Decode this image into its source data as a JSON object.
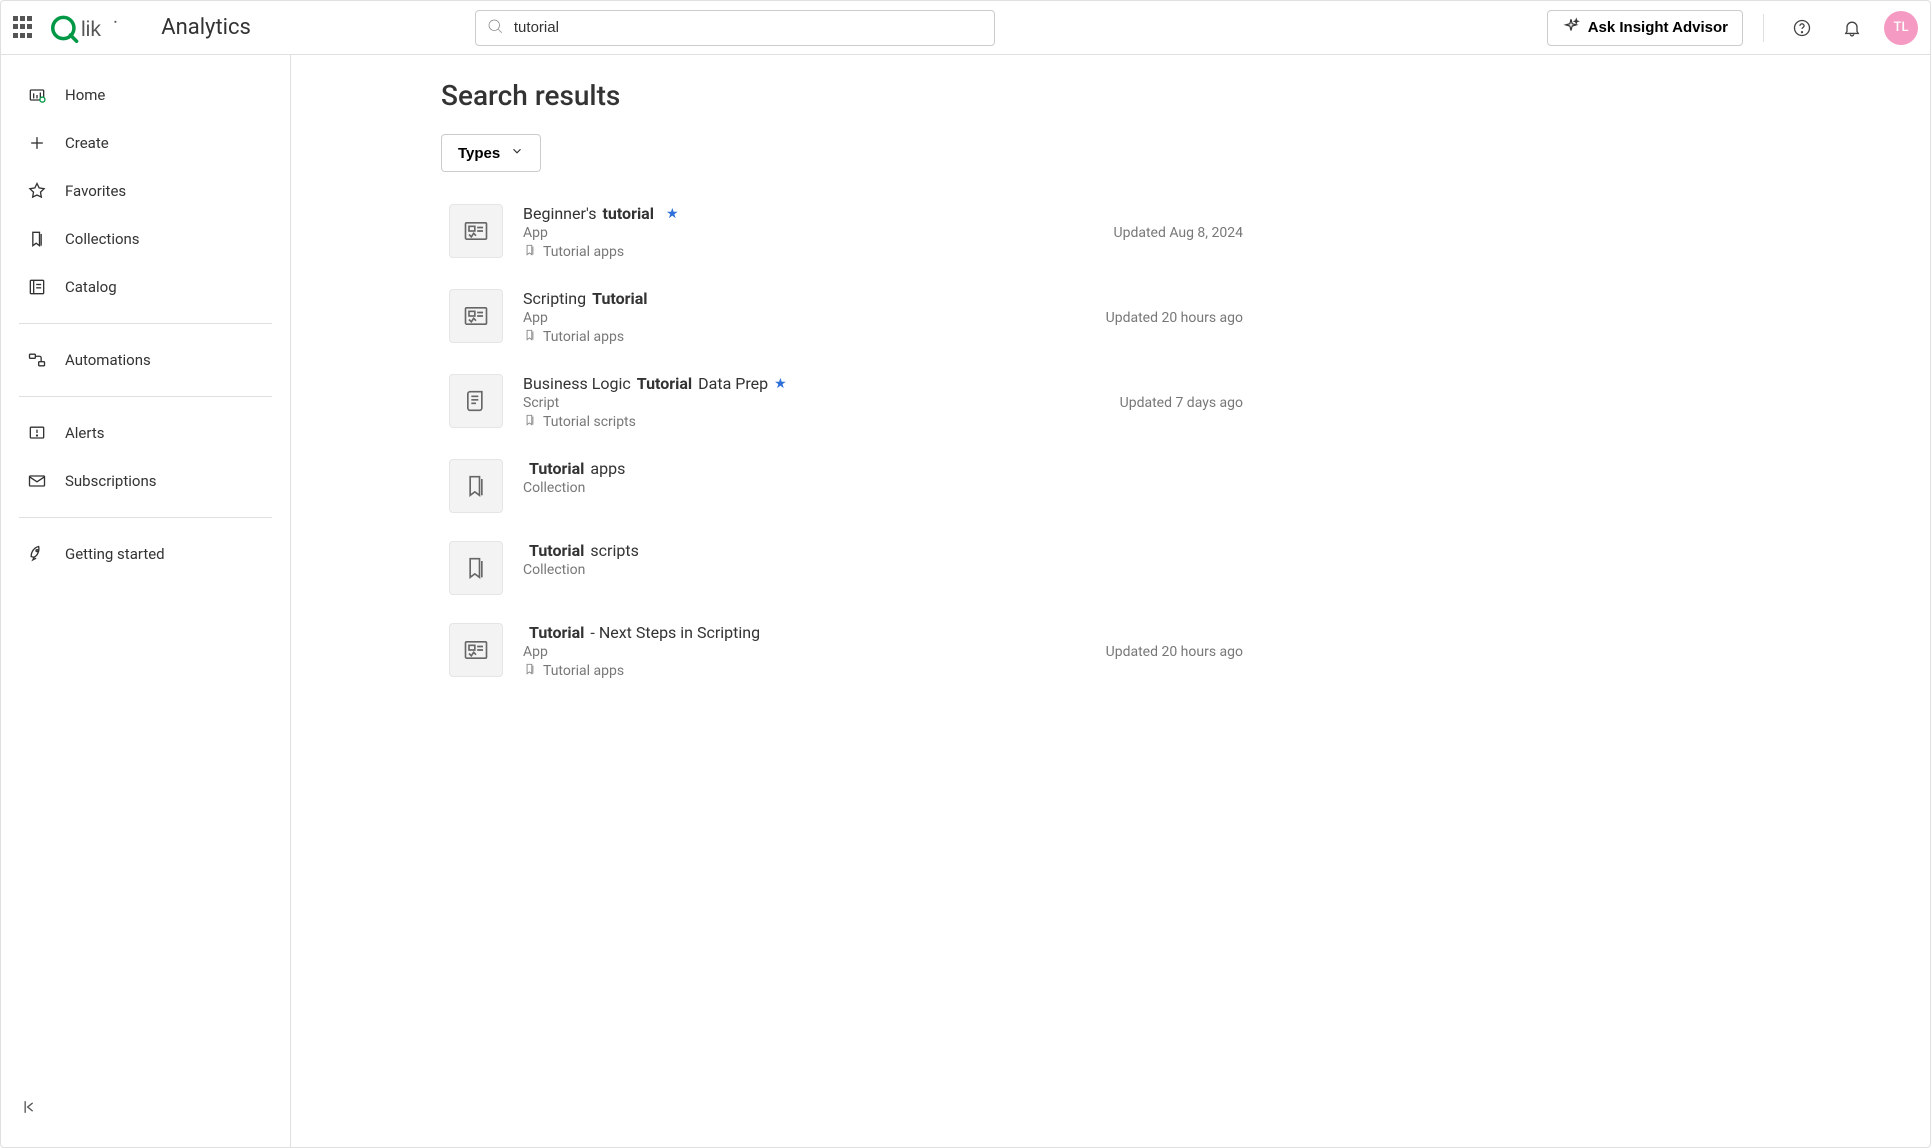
{
  "app_title": "Analytics",
  "search": {
    "value": "tutorial"
  },
  "insight_button": "Ask Insight Advisor",
  "avatar_initials": "TL",
  "sidebar": {
    "items": [
      {
        "label": "Home"
      },
      {
        "label": "Create"
      },
      {
        "label": "Favorites"
      },
      {
        "label": "Collections"
      },
      {
        "label": "Catalog"
      },
      {
        "label": "Automations"
      },
      {
        "label": "Alerts"
      },
      {
        "label": "Subscriptions"
      },
      {
        "label": "Getting started"
      }
    ]
  },
  "page_title": "Search results",
  "filter_label": "Types",
  "results": [
    {
      "title_pre": "Beginner's ",
      "title_bold": "tutorial",
      "title_post": "",
      "starred": true,
      "type": "App",
      "collection": "Tutorial apps",
      "updated": "Updated Aug 8, 2024",
      "icon": "app"
    },
    {
      "title_pre": "Scripting ",
      "title_bold": "Tutorial",
      "title_post": "",
      "starred": false,
      "type": "App",
      "collection": "Tutorial apps",
      "updated": "Updated 20 hours ago",
      "icon": "app"
    },
    {
      "title_pre": "Business Logic ",
      "title_bold": "Tutorial",
      "title_post": " Data Prep",
      "starred": true,
      "type": "Script",
      "collection": "Tutorial scripts",
      "updated": "Updated 7 days ago",
      "icon": "script"
    },
    {
      "title_pre": "",
      "title_bold": "Tutorial",
      "title_post": " apps",
      "starred": false,
      "type": "Collection",
      "collection": "",
      "updated": "",
      "icon": "collection"
    },
    {
      "title_pre": "",
      "title_bold": "Tutorial",
      "title_post": " scripts",
      "starred": false,
      "type": "Collection",
      "collection": "",
      "updated": "",
      "icon": "collection"
    },
    {
      "title_pre": "",
      "title_bold": "Tutorial",
      "title_post": " - Next Steps in Scripting",
      "starred": false,
      "type": "App",
      "collection": "Tutorial apps",
      "updated": "Updated 20 hours ago",
      "icon": "app"
    }
  ]
}
